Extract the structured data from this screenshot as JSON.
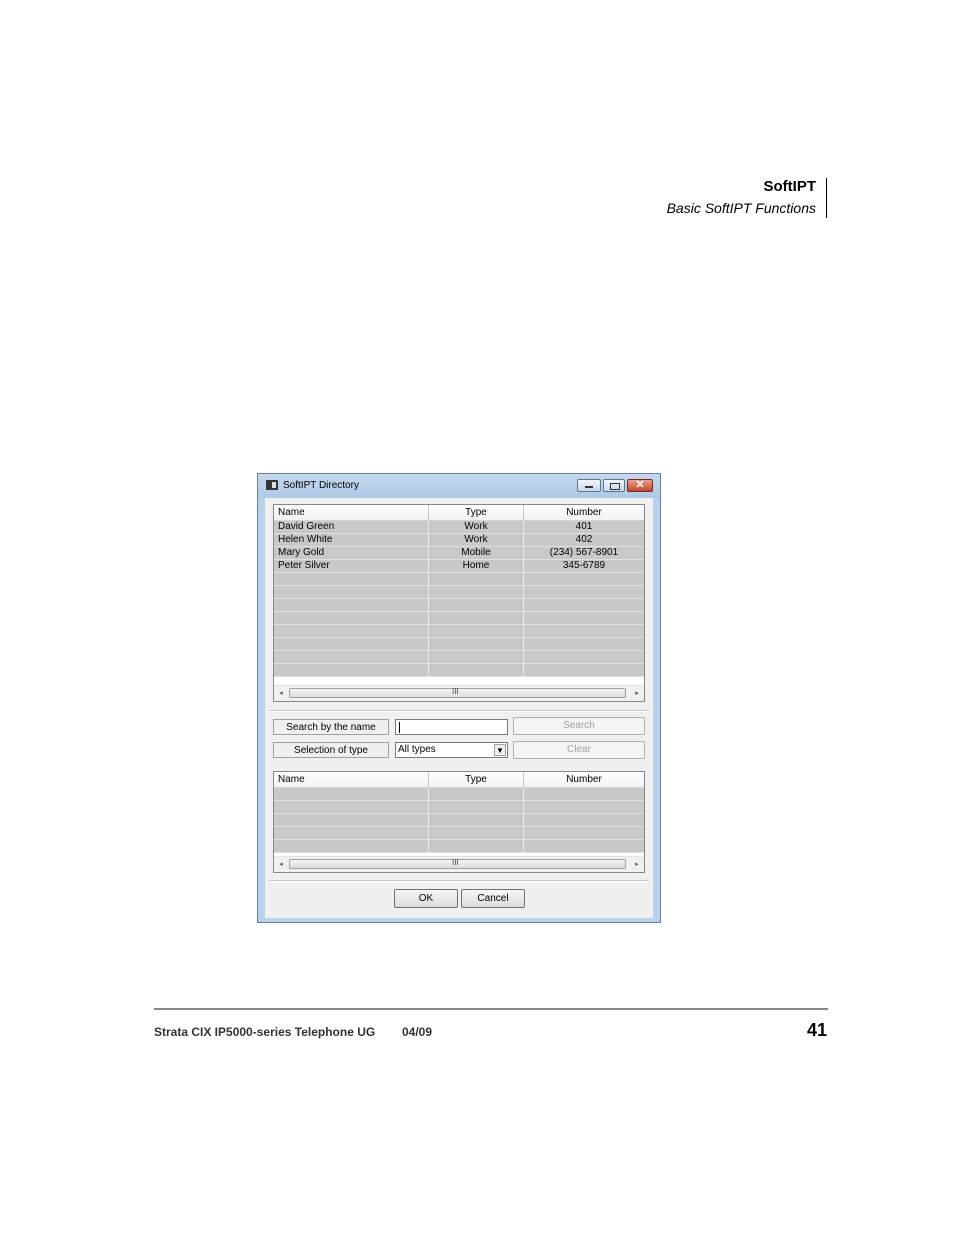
{
  "page_header": {
    "title": "SoftIPT",
    "subtitle": "Basic SoftIPT Functions"
  },
  "window": {
    "title": "SoftIPT Directory",
    "controls": {
      "close_glyph": "✕"
    },
    "directory_list": {
      "columns": [
        "Name",
        "Type",
        "Number"
      ],
      "rows": [
        {
          "name": "David Green",
          "type": "Work",
          "number": "401"
        },
        {
          "name": "Helen White",
          "type": "Work",
          "number": "402"
        },
        {
          "name": "Mary Gold",
          "type": "Mobile",
          "number": "(234) 567-8901"
        },
        {
          "name": "Peter Silver",
          "type": "Home",
          "number": "345-6789"
        },
        {
          "name": "",
          "type": "",
          "number": ""
        },
        {
          "name": "",
          "type": "",
          "number": ""
        },
        {
          "name": "",
          "type": "",
          "number": ""
        },
        {
          "name": "",
          "type": "",
          "number": ""
        },
        {
          "name": "",
          "type": "",
          "number": ""
        },
        {
          "name": "",
          "type": "",
          "number": ""
        },
        {
          "name": "",
          "type": "",
          "number": ""
        },
        {
          "name": "",
          "type": "",
          "number": ""
        }
      ]
    },
    "search": {
      "name_label": "Search by the name",
      "name_value": "",
      "type_label": "Selection of type",
      "type_selected": "All types",
      "search_button": "Search",
      "clear_button": "Clear"
    },
    "results_list": {
      "columns": [
        "Name",
        "Type",
        "Number"
      ],
      "rows": [
        {
          "name": "",
          "type": "",
          "number": ""
        },
        {
          "name": "",
          "type": "",
          "number": ""
        },
        {
          "name": "",
          "type": "",
          "number": ""
        },
        {
          "name": "",
          "type": "",
          "number": ""
        },
        {
          "name": "",
          "type": "",
          "number": ""
        }
      ]
    },
    "scrollbar": {
      "left_arrow": "◂",
      "right_arrow": "▸",
      "grip": "III"
    },
    "ok_button": "OK",
    "cancel_button": "Cancel"
  },
  "footer": {
    "doc_title": "Strata CIX IP5000-series Telephone UG",
    "date": "04/09",
    "page_number": "41"
  }
}
